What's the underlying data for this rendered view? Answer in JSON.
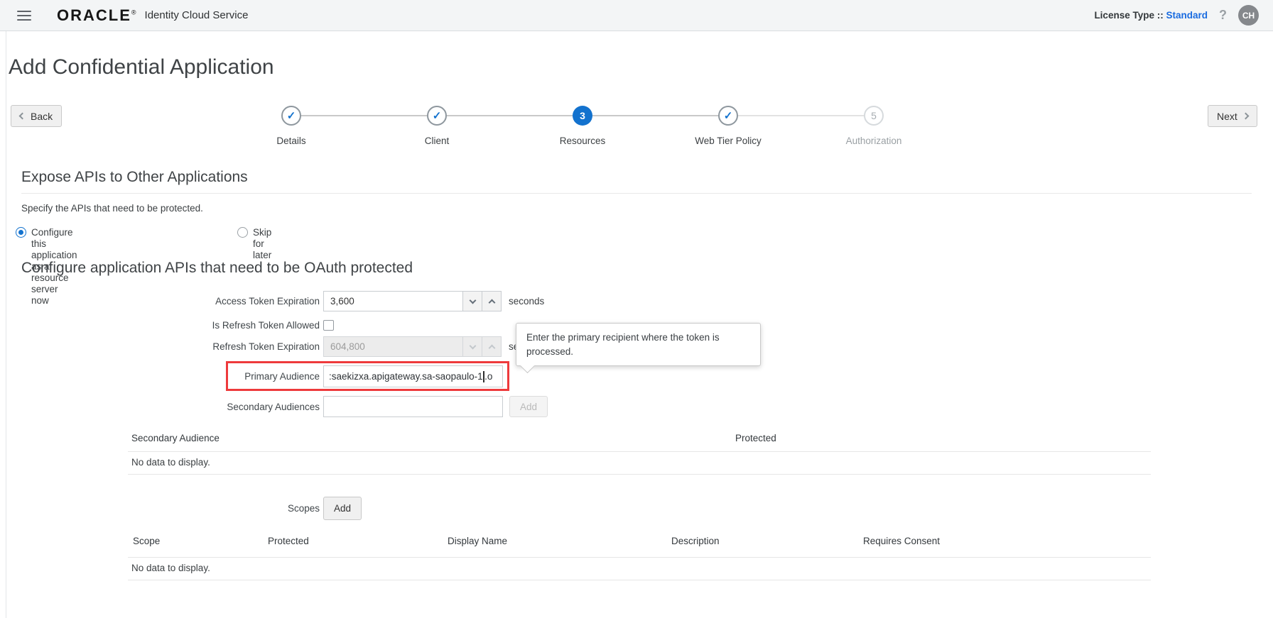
{
  "topbar": {
    "brand": "ORACLE",
    "brand_registered": "®",
    "product": "Identity Cloud Service",
    "license_label": "License Type ::",
    "license_value": "Standard",
    "help_glyph": "?",
    "avatar_initials": "CH"
  },
  "page": {
    "title": "Add Confidential Application",
    "back_label": "Back",
    "next_label": "Next"
  },
  "wizard": {
    "steps": [
      {
        "label": "Details",
        "state": "complete"
      },
      {
        "label": "Client",
        "state": "complete"
      },
      {
        "label": "Resources",
        "state": "active",
        "number": "3"
      },
      {
        "label": "Web Tier Policy",
        "state": "complete"
      },
      {
        "label": "Authorization",
        "state": "future",
        "number": "5"
      }
    ],
    "check_glyph": "✓"
  },
  "expose": {
    "heading": "Expose APIs to Other Applications",
    "subtext": "Specify the APIs that need to be protected.",
    "radio_configure_label": "Configure this application as a resource server now",
    "radio_skip_label": "Skip for later"
  },
  "configure": {
    "heading": "Configure application APIs that need to be OAuth protected",
    "access_token_label": "Access Token Expiration",
    "access_token_value": "3,600",
    "access_token_unit": "seconds",
    "refresh_allowed_label": "Is Refresh Token Allowed",
    "refresh_token_label": "Refresh Token Expiration",
    "refresh_token_value": "604,800",
    "refresh_token_unit": "seconds",
    "primary_audience_label": "Primary Audience",
    "primary_audience_value_before_caret": ":saekizxa.apigateway.sa-saopaulo-1",
    "primary_audience_value_after_caret": ".o",
    "secondary_audiences_label": "Secondary Audiences",
    "secondary_add_label": "Add",
    "scopes_label": "Scopes",
    "scopes_add_label": "Add"
  },
  "tooltip": {
    "text": "Enter the primary recipient where the token is processed."
  },
  "secondary_table": {
    "headers": [
      "Secondary Audience",
      "Protected"
    ],
    "empty": "No data to display."
  },
  "scope_table": {
    "headers": [
      "Scope",
      "Protected",
      "Display Name",
      "Description",
      "Requires Consent"
    ],
    "empty": "No data to display."
  },
  "colors": {
    "accent_blue": "#1372ce",
    "link_blue": "#1a6ce0",
    "highlight_red": "#ee3a3c",
    "topbar_bg": "#f3f5f6"
  }
}
